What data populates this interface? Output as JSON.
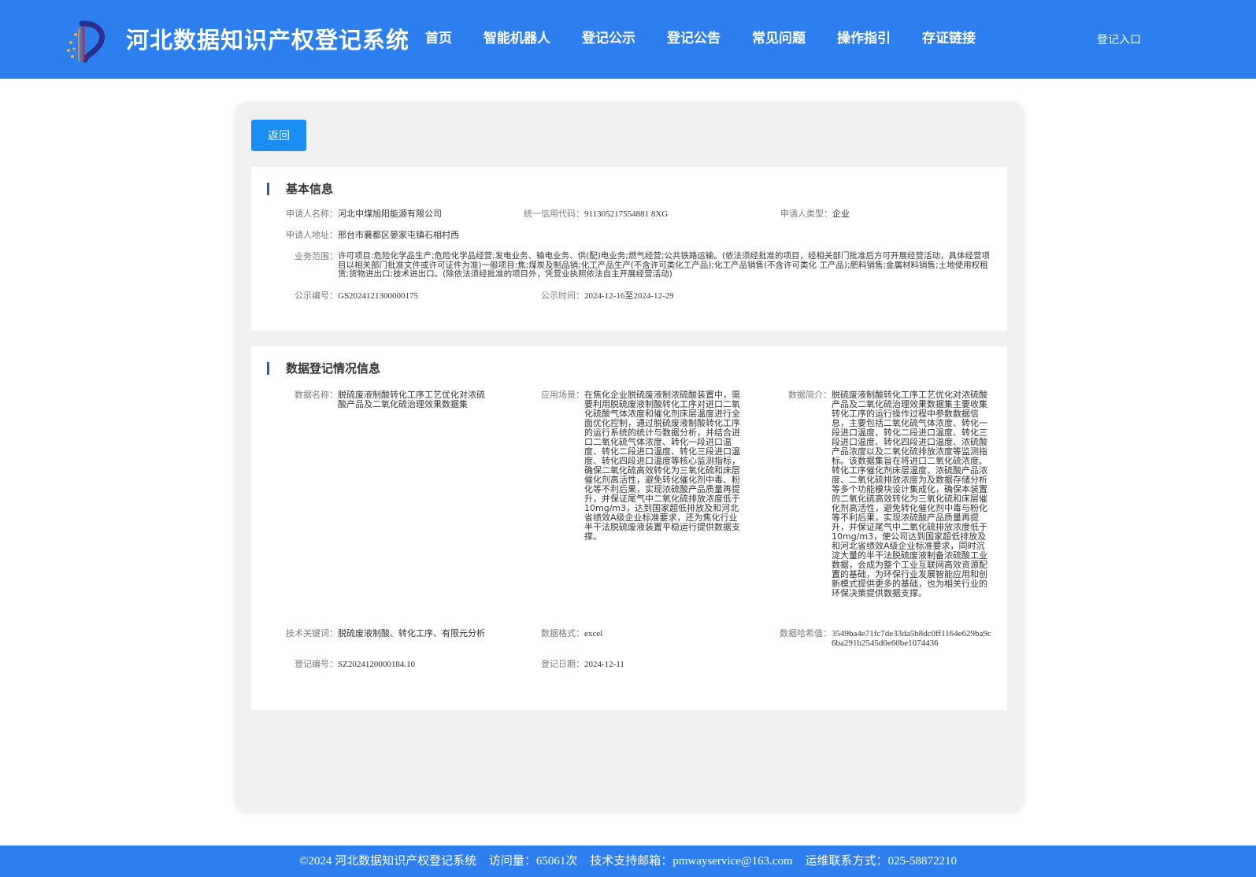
{
  "header": {
    "title": "河北数据知识产权登记系统",
    "nav": [
      "首页",
      "智能机器人",
      "登记公示",
      "登记公告",
      "常见问题",
      "操作指引",
      "存证链接"
    ],
    "login_label": "登记入口"
  },
  "back_label": "返回",
  "basic": {
    "title": "基本信息",
    "applicant_name_label": "申请人名称：",
    "applicant_name": "河北中煤旭阳能源有限公司",
    "credit_code_label": "统一信用代码：",
    "credit_code": "911305217554881 8XG",
    "applicant_type_label": "申请人类型：",
    "applicant_type": "企业",
    "address_label": "申请人地址：",
    "address": "邢台市襄都区晏家屯镇石相村西",
    "scope_label": "业务范围：",
    "scope": "许可项目:危险化学品生产;危险化学品经营;发电业务、输电业务、供(配)电业务;燃气经营;公共铁路运输。(依法须经批准的项目，经相关部门批准后方可开展经营活动，具体经营项目以相关部门批准文件或许可证件为准)一般项目:焦;煤炭及制品销;化工产品生产(不含许可类化工产品);化工产品销售(不含许可类化 工产品);肥料销售;金属材料销售;土地使用权租赁;货物进出口;技术进出口。(除依法须经批准的项目外，凭营业执照依法自主开展经营活动)",
    "pub_no_label": "公示编号：",
    "pub_no": "GS2024121300000175",
    "pub_time_label": "公示时间：",
    "pub_time": "2024-12-16至2024-12-29"
  },
  "data_reg": {
    "title": "数据登记情况信息",
    "data_name_label": "数据名称：",
    "data_name": "脱硫废液制酸转化工序工艺优化对浓硫酸产品及二氧化硫治理效果数据集",
    "scenario_label": "应用场景：",
    "scenario": "在焦化企业脱硫废液制浓硫酸装置中，需要利用脱硫废液制酸转化工序对进口二氧化硫酸气体浓度和催化剂床层温度进行全面优化控制，通过脱硫废液制酸转化工序的运行系统的统计与数据分析，并结合进口二氧化硫气体浓度、转化一段进口温度、转化二段进口温度、转化三段进口温度、转化四段进口温度等核心监测指标，确保二氧化硫高效转化为三氧化硫和床层催化剂高活性，避免转化催化剂中毒、粉化等不利后果，实现浓硫酸产品质量再提升，并保证尾气中二氧化硫排放浓度低于10mg/m3，达到国家超低排放及和河北省绩效A级企业标准要求，还为焦化行业半干法脱硫废液装置平稳运行提供数据支撑。",
    "intro_label": "数据简介：",
    "intro": "脱硫废液制酸转化工序工艺优化对浓硫酸产品及二氧化硫治理效果数据集主要收集转化工序的运行操作过程中参数数据信息，主要包括二氧化硫气体浓度、转化一段进口温度、转化二段进口温度、转化三段进口温度、转化四段进口温度、浓硫酸产品浓度以及二氧化硫排放浓度等监测指标。该数据集旨在将进口二氧化硫浓度、转化工序催化剂床层温度、浓硫酸产品浓度、二氧化硫排放浓度为及数据存储分析等多个功能模块设计集成化，确保本装置的二氧化硫高效转化为三氧化硫和床层催化剂高活性，避免转化催化剂中毒与粉化等不利后果，实现浓硫酸产品质量再提升，并保证尾气中二氧化硫排放浓度低于10mg/m3，使公司达到国家超低排放及和河北省绩效A级企业标准要求，同时沉淀大量的半干法脱硫废液制备浓硫酸工业数据，会成为整个工业互联网高效资源配置的基础，为环保行业发展智能应用和创新模式提供更多的基础，也为相关行业的环保决策提供数据支撑。",
    "keywords_label": "技术关键词：",
    "keywords": "脱硫废液制酸、转化工序、有限元分析",
    "format_label": "数据格式：",
    "format": "excel",
    "hash_label": "数据哈希值：",
    "hash": "3549ba4e71fc7de33da5b8dc0ff1164e629ba9c6ba291b2545d0e60be1074436",
    "reg_no_label": "登记编号：",
    "reg_no": "SZ2024120000184.10",
    "reg_date_label": "登记日期：",
    "reg_date": "2024-12-11"
  },
  "footer": {
    "copyright": "©2024 河北数据知识产权登记系统",
    "visits": "访问量：65061次",
    "email": "技术支持邮箱：pmwayservice@163.com",
    "contact": "运维联系方式：025-58872210"
  }
}
